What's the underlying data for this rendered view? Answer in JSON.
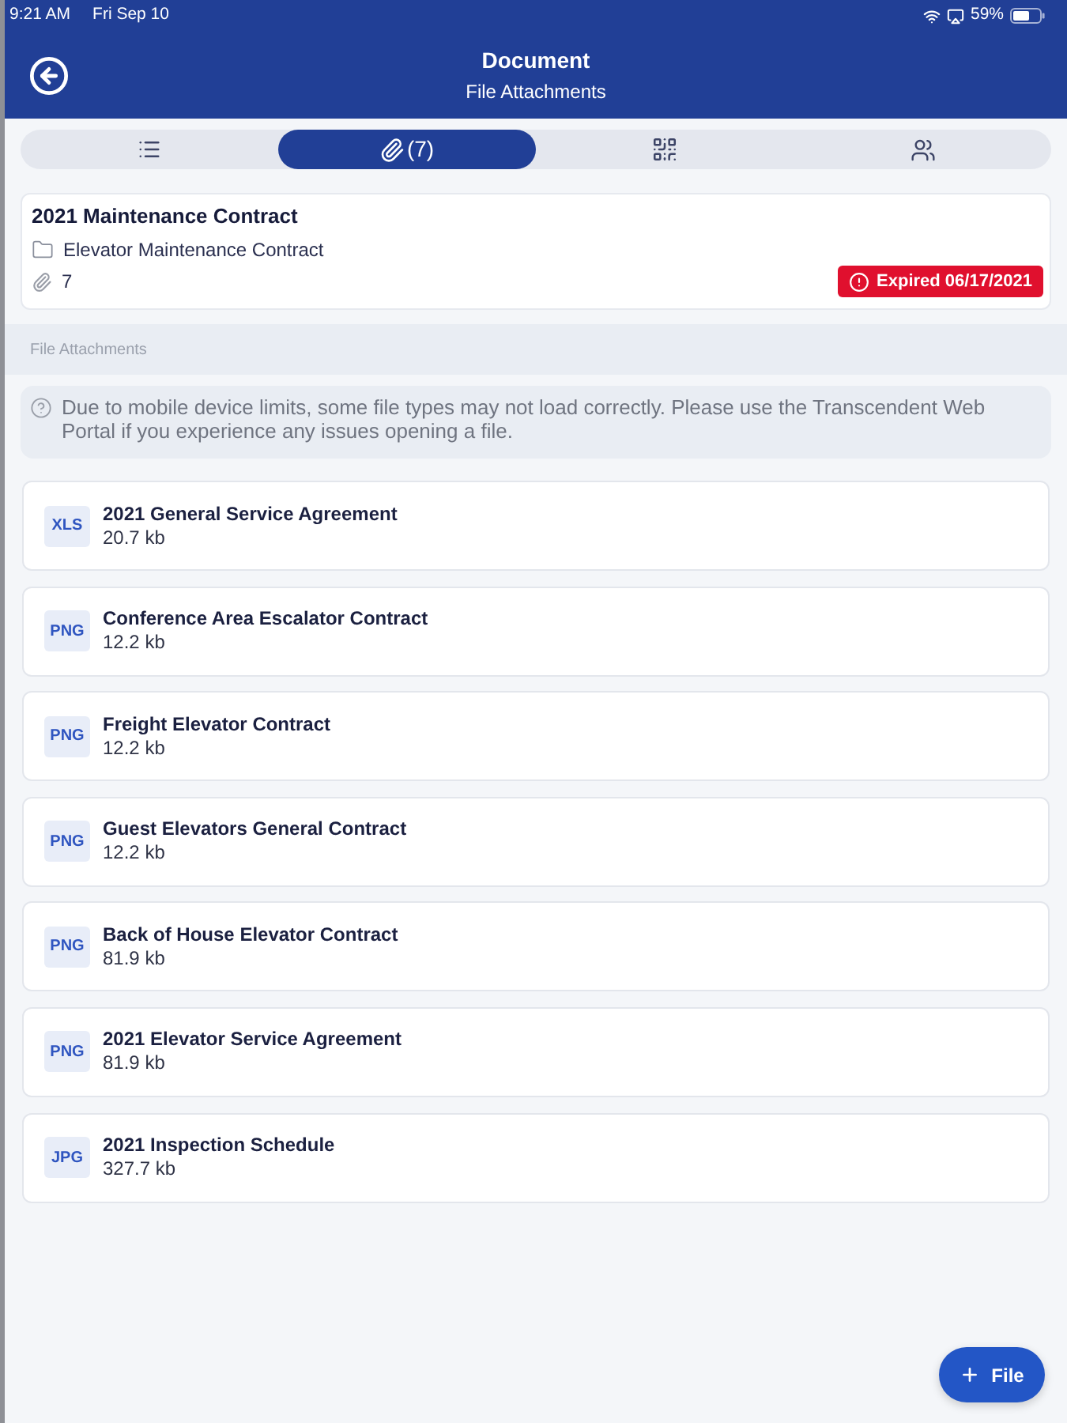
{
  "status_bar": {
    "time": "9:21 AM",
    "date": "Fri Sep 10",
    "battery": "59%"
  },
  "header": {
    "title": "Document",
    "subtitle": "File Attachments"
  },
  "tabs": [
    {
      "kind": "list",
      "selected": false
    },
    {
      "kind": "attachments",
      "label": "(7)",
      "selected": true
    },
    {
      "kind": "qr",
      "selected": false
    },
    {
      "kind": "people",
      "selected": false
    }
  ],
  "document": {
    "title": "2021 Maintenance Contract",
    "folder": "Elevator Maintenance Contract",
    "attachment_count": "7",
    "status": "Expired 06/17/2021"
  },
  "section_title": "File Attachments",
  "notice": "Due to mobile device limits, some file types may not load correctly. Please use the Transcendent Web Portal if you experience any issues opening a file.",
  "files": [
    {
      "type": "XLS",
      "name": "2021 General Service Agreement",
      "size": "20.7 kb"
    },
    {
      "type": "PNG",
      "name": "Conference Area Escalator Contract",
      "size": "12.2 kb"
    },
    {
      "type": "PNG",
      "name": "Freight Elevator Contract",
      "size": "12.2 kb"
    },
    {
      "type": "PNG",
      "name": "Guest Elevators General Contract",
      "size": "12.2 kb"
    },
    {
      "type": "PNG",
      "name": "Back of House Elevator Contract",
      "size": "81.9 kb"
    },
    {
      "type": "PNG",
      "name": "2021 Elevator Service Agreement",
      "size": "81.9 kb"
    },
    {
      "type": "JPG",
      "name": "2021 Inspection Schedule",
      "size": "327.7 kb"
    }
  ],
  "add_button": {
    "label": "File"
  }
}
